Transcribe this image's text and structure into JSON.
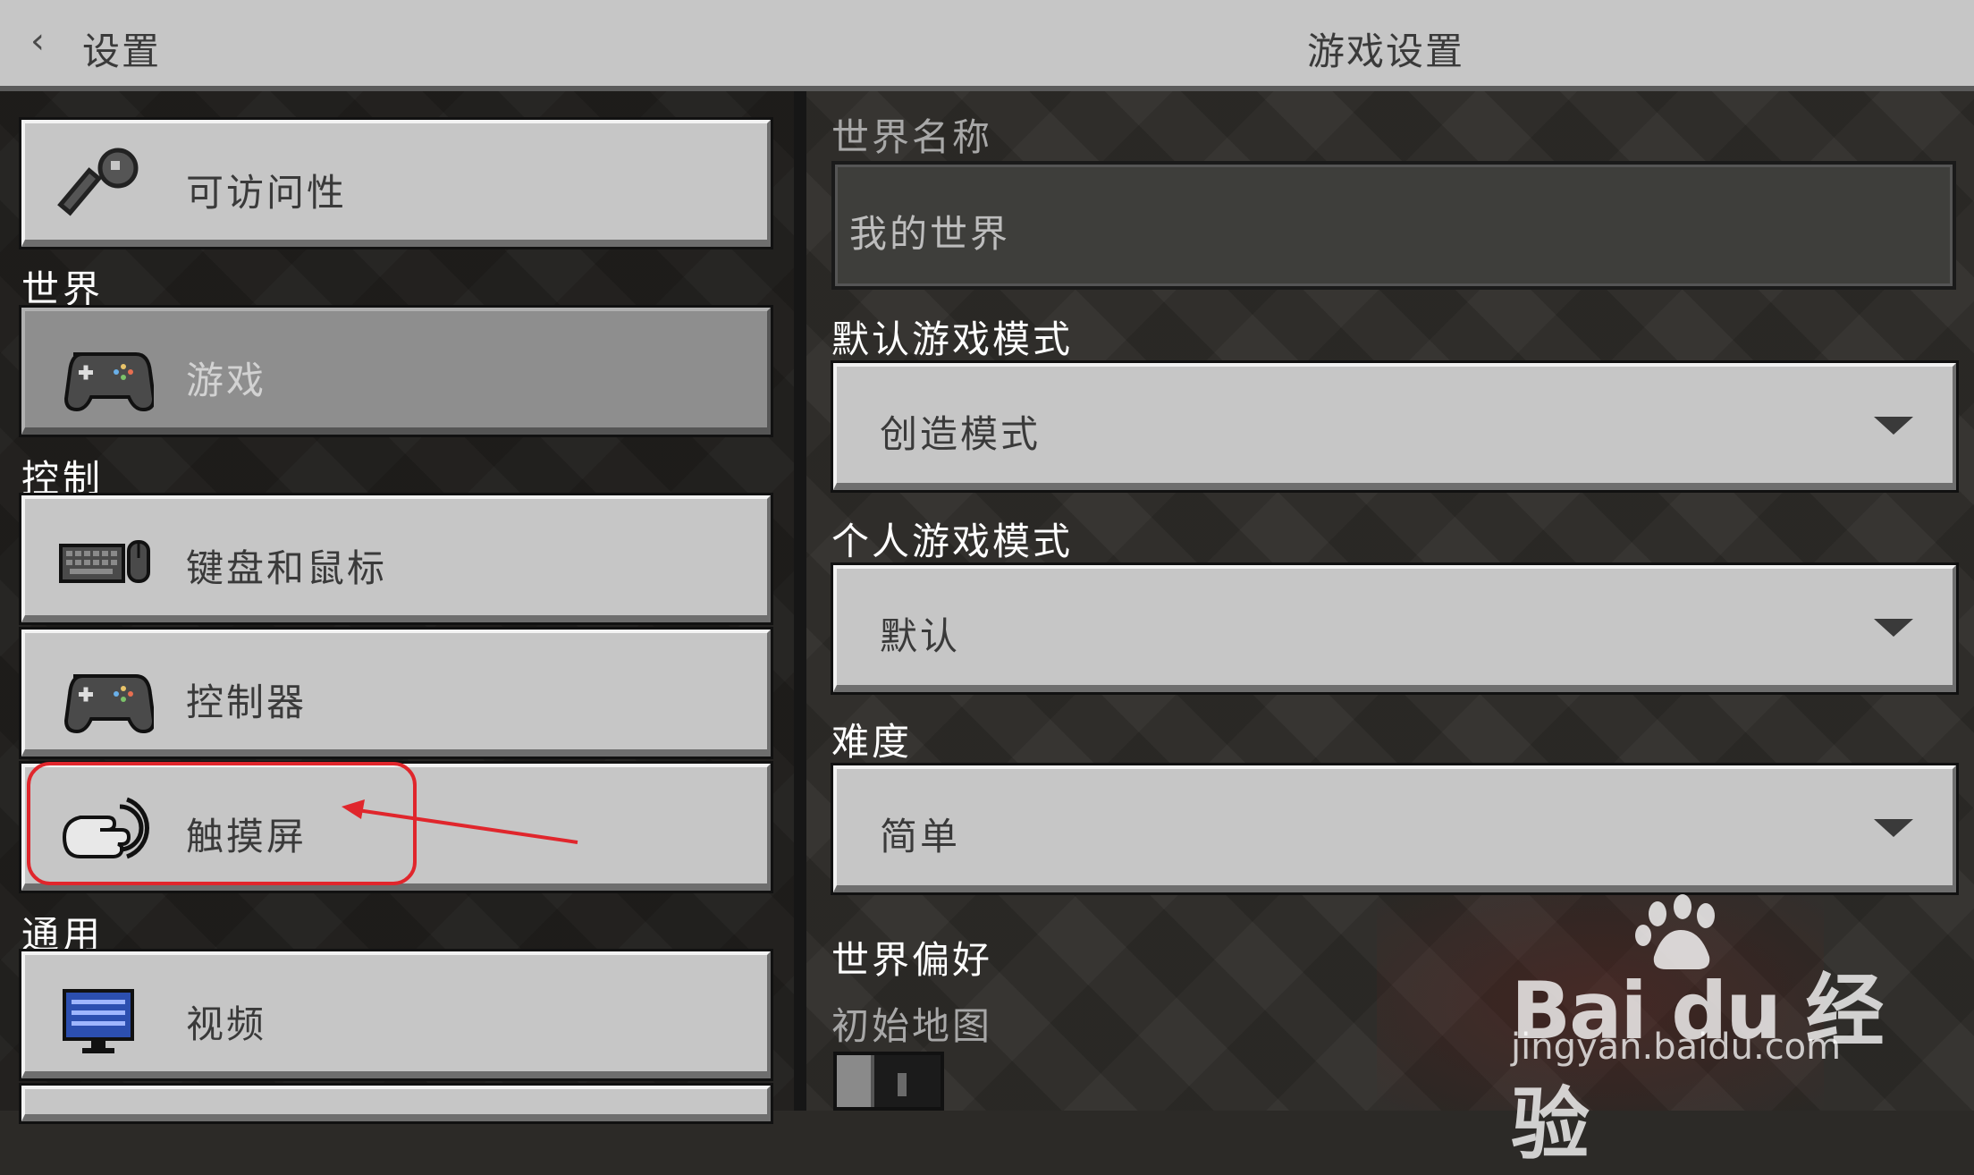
{
  "header": {
    "back_label": "设置",
    "title": "游戏设置"
  },
  "sidebar": {
    "items": [
      {
        "label": "可访问性",
        "icon": "key-icon"
      },
      {
        "label": "游戏",
        "icon": "gamepad-icon",
        "active": true
      },
      {
        "label": "键盘和鼠标",
        "icon": "keyboard-icon"
      },
      {
        "label": "控制器",
        "icon": "controller-icon"
      },
      {
        "label": "触摸屏",
        "icon": "touch-icon"
      },
      {
        "label": "视频",
        "icon": "monitor-icon"
      }
    ],
    "sections": {
      "world": "世界",
      "controls": "控制",
      "general": "通用"
    }
  },
  "main": {
    "world_name": {
      "label": "世界名称",
      "value": "我的世界"
    },
    "default_mode": {
      "label": "默认游戏模式",
      "value": "创造模式"
    },
    "personal_mode": {
      "label": "个人游戏模式",
      "value": "默认"
    },
    "difficulty": {
      "label": "难度",
      "value": "简单"
    },
    "world_prefs": {
      "label": "世界偏好"
    },
    "starting_map": {
      "label": "初始地图",
      "enabled": false
    }
  },
  "watermark": {
    "brand": "Bai du 经验",
    "url": "jingyan.baidu.com"
  },
  "colors": {
    "annotation": "#e0262c",
    "button": "#c6c6c6",
    "active_button": "#8e8e8e"
  }
}
